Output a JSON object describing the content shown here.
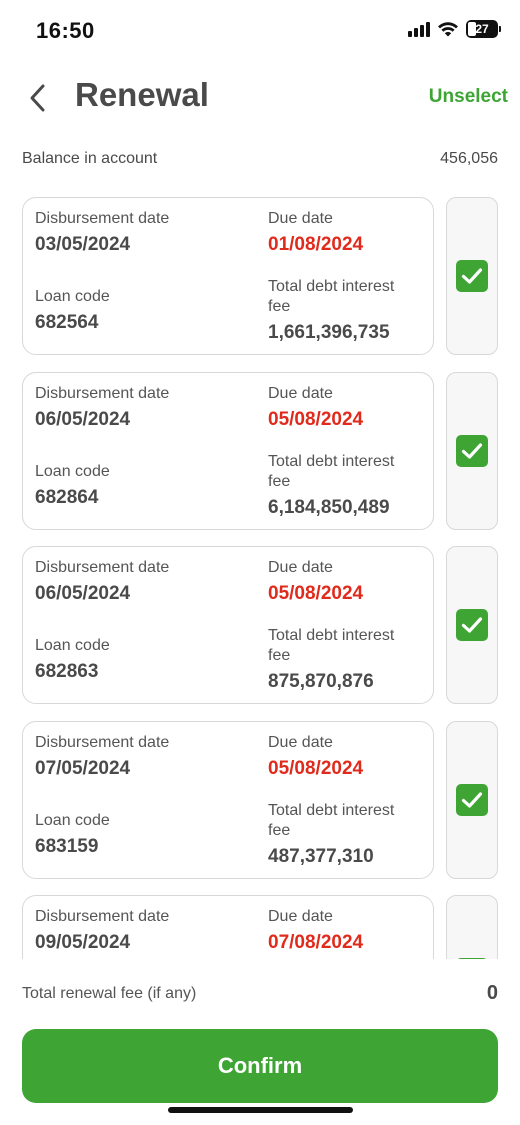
{
  "status_bar": {
    "time": "16:50",
    "battery_level": "27"
  },
  "header": {
    "title": "Renewal",
    "unselect_label": "Unselect",
    "back_icon": "chevron-left-icon"
  },
  "balance": {
    "label": "Balance in account",
    "value": "456,056"
  },
  "labels": {
    "disbursement_date": "Disbursement date",
    "due_date": "Due date",
    "loan_code": "Loan code",
    "total_debt_line1": "Total debt interest",
    "total_debt_line2": "fee"
  },
  "loans": [
    {
      "disbursement_date": "03/05/2024",
      "due_date": "01/08/2024",
      "loan_code": "682564",
      "total_debt": "1,661,396,735",
      "checked": true
    },
    {
      "disbursement_date": "06/05/2024",
      "due_date": "05/08/2024",
      "loan_code": "682864",
      "total_debt": "6,184,850,489",
      "checked": true
    },
    {
      "disbursement_date": "06/05/2024",
      "due_date": "05/08/2024",
      "loan_code": "682863",
      "total_debt": "875,870,876",
      "checked": true
    },
    {
      "disbursement_date": "07/05/2024",
      "due_date": "05/08/2024",
      "loan_code": "683159",
      "total_debt": "487,377,310",
      "checked": true
    },
    {
      "disbursement_date": "09/05/2024",
      "due_date": "07/08/2024",
      "loan_code": "",
      "total_debt": "",
      "checked": true
    }
  ],
  "footer": {
    "total_label": "Total renewal fee (if any)",
    "total_value": "0",
    "confirm_label": "Confirm"
  },
  "colors": {
    "accent_green": "#3ea535",
    "due_red": "#e02a1c",
    "text": "#4a4a4a",
    "border": "#d8d8d8"
  }
}
